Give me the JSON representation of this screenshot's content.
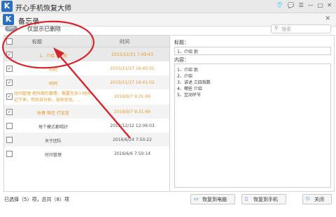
{
  "app": {
    "title": "开心手机恢复大师",
    "logo": "K"
  },
  "memo": {
    "title": "备忘录",
    "logo": "K",
    "close": "✕"
  },
  "filter": {
    "toggle": "OFF",
    "label": "仅显示已删除",
    "search_placeholder": "搜索"
  },
  "list": {
    "col_title": "标题",
    "col_time": "时间",
    "rows": [
      {
        "checked": true,
        "title": "1、介绍…计划",
        "time": "2015/12/31 7:49:43",
        "color": "orange"
      },
      {
        "checked": true,
        "title": "呵呵",
        "time": "2015/11/17 16:45:01",
        "color": "orange"
      },
      {
        "checked": true,
        "title": "呵呵",
        "time": "2015/11/17 16:41:02",
        "color": "orange"
      },
      {
        "checked": true,
        "title": "时间管理 把所做的事情，需要完多少时间记下来，然后去分析，如何优化。…",
        "time": "2016/9/7 9:31:49",
        "color": "orange"
      },
      {
        "checked": true,
        "title": "咏春 微信 打宣宣",
        "time": "2016/9/7 9:31:49",
        "color": "orange"
      },
      {
        "checked": false,
        "title": "每个模式都喝好",
        "time": "2016/12/12 12:06:03",
        "color": "gray"
      },
      {
        "checked": false,
        "title": "关于团队",
        "time": "2016/6/24 7:50:22",
        "color": "gray"
      },
      {
        "checked": false,
        "title": "时间管理",
        "time": "2016/6/6 7:50:14",
        "color": "gray"
      }
    ]
  },
  "status": "已选择（5）项，总共（8）项",
  "detail": {
    "title_label": "标题：",
    "title_value": "1、介绍      划",
    "content_label": "内容：",
    "content_lines": [
      "1、介绍      划",
      "2、介绍",
      "3、讲述      三四指数",
      "4、哪些      介绍",
      "5、互动环节"
    ]
  },
  "buttons": {
    "restore_pc": "恢复到电脑",
    "restore_phone": "恢复到手机",
    "close": "关闭"
  },
  "icons": {
    "skin": "shirt-icon",
    "chat": "chat-icon",
    "menu": "menu-icon",
    "min": "minimize-icon",
    "max": "maximize-icon",
    "close": "close-icon"
  },
  "colors": {
    "accent": "#2b6fc4",
    "orange": "#e39a2d",
    "annotation": "#d9232b"
  }
}
